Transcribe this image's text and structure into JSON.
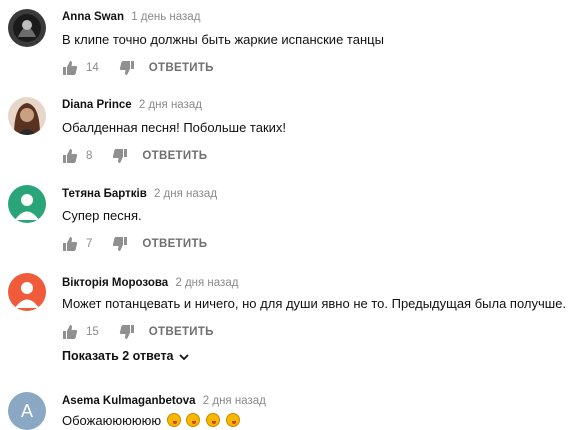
{
  "comments": [
    {
      "author": "Anna Swan",
      "time": "1 день назад",
      "text": "В клипе точно должны быть жаркие испанские танцы",
      "likes": "14",
      "reply_label": "ОТВЕТИТЬ",
      "avatar_color": "#2b2b2b"
    },
    {
      "author": "Diana Prince",
      "time": "2 дня назад",
      "text": "Обалденная песня! Побольше таких!",
      "likes": "8",
      "reply_label": "ОТВЕТИТЬ",
      "avatar_color": "#8b5a3c"
    },
    {
      "author": "Тетяна Бартків",
      "time": "2 дня назад",
      "text": "Супер песня.",
      "likes": "7",
      "reply_label": "ОТВЕТИТЬ",
      "avatar_color": "#2aa57a"
    },
    {
      "author": "Вікторія Морозова",
      "time": "2 дня назад",
      "text": "Может потанцевать и ничего, но для души явно не то. Предыдущая была получше.",
      "likes": "15",
      "reply_label": "ОТВЕТИТЬ",
      "avatar_color": "#ef5b3b",
      "show_replies": "Показать 2 ответа"
    },
    {
      "author": "Asema Kulmaganbetova",
      "time": "2 дня назад",
      "text": "Обожаюююююю",
      "avatar_color": "#8aa7c4",
      "avatar_letter": "A",
      "emoji_icons": [
        "face-kiss-icon",
        "face-kiss-icon",
        "face-kiss-icon",
        "face-kiss-icon"
      ]
    }
  ]
}
